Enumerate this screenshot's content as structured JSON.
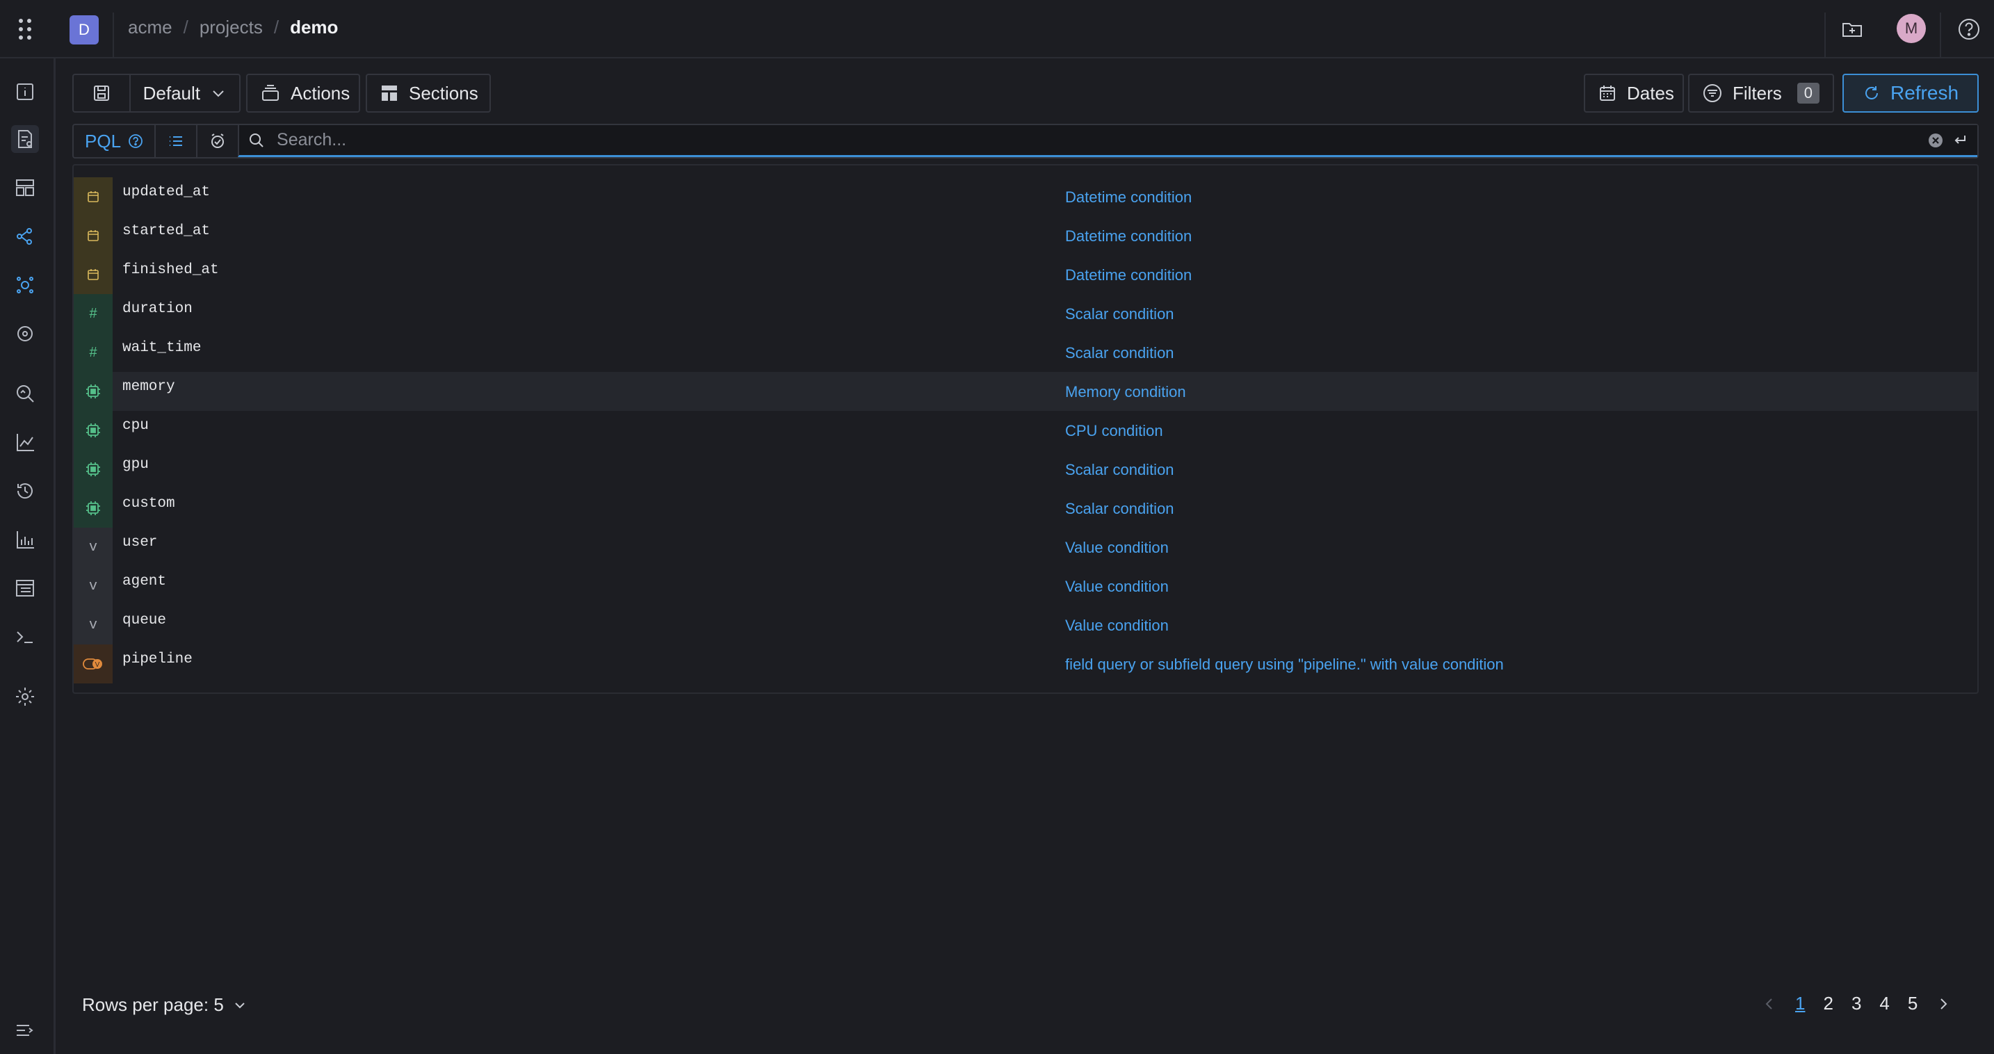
{
  "breadcrumb": {
    "org": "acme",
    "section": "projects",
    "current": "demo"
  },
  "logo_letter": "D",
  "avatar_letter": "M",
  "toolbar": {
    "view": "Default",
    "actions": "Actions",
    "sections": "Sections",
    "dates": "Dates",
    "filters": "Filters",
    "filters_count": "0",
    "refresh": "Refresh"
  },
  "search": {
    "mode": "PQL",
    "placeholder": "Search..."
  },
  "suggestions": [
    {
      "type": "datetime",
      "name": "updated_at",
      "desc": "Datetime condition"
    },
    {
      "type": "datetime",
      "name": "started_at",
      "desc": "Datetime condition"
    },
    {
      "type": "datetime",
      "name": "finished_at",
      "desc": "Datetime condition"
    },
    {
      "type": "scalar",
      "name": "duration",
      "desc": "Scalar condition"
    },
    {
      "type": "scalar",
      "name": "wait_time",
      "desc": "Scalar condition"
    },
    {
      "type": "resource",
      "name": "memory",
      "desc": "Memory condition"
    },
    {
      "type": "resource",
      "name": "cpu",
      "desc": "CPU condition"
    },
    {
      "type": "resource",
      "name": "gpu",
      "desc": "Scalar condition"
    },
    {
      "type": "resource",
      "name": "custom",
      "desc": "Scalar condition"
    },
    {
      "type": "value",
      "name": "user",
      "desc": "Value condition"
    },
    {
      "type": "value",
      "name": "agent",
      "desc": "Value condition"
    },
    {
      "type": "value",
      "name": "queue",
      "desc": "Value condition"
    },
    {
      "type": "pipeline",
      "name": "pipeline",
      "desc": "field query or subfield query using \"pipeline.\" with value condition"
    }
  ],
  "type_glyphs": {
    "scalar": "#",
    "value": "v"
  },
  "pagination": {
    "rows_per_page_label": "Rows per page: 5",
    "pages": [
      "1",
      "2",
      "3",
      "4",
      "5"
    ],
    "current_page": "1"
  },
  "colors": {
    "accent": "#4aa3f0",
    "background": "#1c1d22",
    "logo": "#6a74d6"
  }
}
